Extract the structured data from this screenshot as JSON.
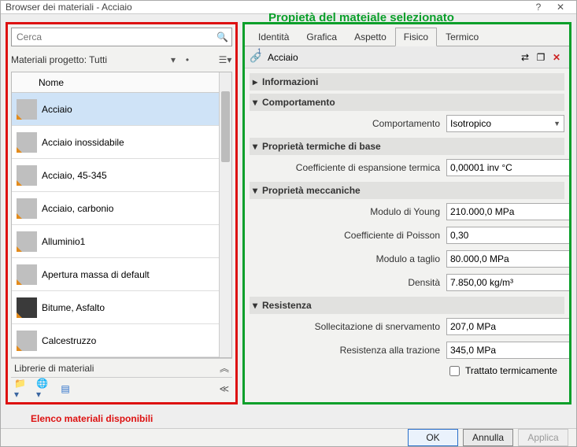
{
  "window": {
    "title": "Browser dei materiali - Acciaio"
  },
  "annotations": {
    "top_green": "Propietà del mateiale selezionato",
    "bottom_red": "Elenco materiali disponibili"
  },
  "search": {
    "placeholder": "Cerca"
  },
  "filter": {
    "label": "Materiali progetto: Tutti"
  },
  "list": {
    "column_header": "Nome",
    "items": [
      {
        "name": "Acciaio",
        "selected": true,
        "dark": false
      },
      {
        "name": "Acciaio inossidabile",
        "selected": false,
        "dark": false
      },
      {
        "name": "Acciaio, 45-345",
        "selected": false,
        "dark": false
      },
      {
        "name": "Acciaio, carbonio",
        "selected": false,
        "dark": false
      },
      {
        "name": "Alluminio1",
        "selected": false,
        "dark": false
      },
      {
        "name": "Apertura massa di default",
        "selected": false,
        "dark": false
      },
      {
        "name": "Bitume, Asfalto",
        "selected": false,
        "dark": true
      },
      {
        "name": "Calcestruzzo",
        "selected": false,
        "dark": false
      }
    ]
  },
  "libraries_header": "Librerie di materiali",
  "tabs": {
    "items": [
      "Identità",
      "Grafica",
      "Aspetto",
      "Fisico",
      "Termico"
    ],
    "active_index": 3
  },
  "material_header": {
    "index": "1",
    "name": "Acciaio"
  },
  "groups": {
    "informazioni": {
      "title": "Informazioni",
      "expanded": false
    },
    "comportamento": {
      "title": "Comportamento",
      "expanded": true,
      "field_label": "Comportamento",
      "field_value": "Isotropico"
    },
    "termiche": {
      "title": "Proprietà termiche di base",
      "expanded": true,
      "coeff_label": "Coefficiente di espansione termica",
      "coeff_value": "0,00001 inv °C"
    },
    "meccaniche": {
      "title": "Proprietà meccaniche",
      "expanded": true,
      "young_label": "Modulo di Young",
      "young_value": "210.000,0 MPa",
      "poisson_label": "Coefficiente di Poisson",
      "poisson_value": "0,30",
      "taglio_label": "Modulo a taglio",
      "taglio_value": "80.000,0 MPa",
      "dens_label": "Densità",
      "dens_value": "7.850,00 kg/m³"
    },
    "resistenza": {
      "title": "Resistenza",
      "expanded": true,
      "snerv_label": "Sollecitazione di snervamento",
      "snerv_value": "207,0 MPa",
      "traz_label": "Resistenza alla trazione",
      "traz_value": "345,0 MPa",
      "heat_label": "Trattato termicamente"
    }
  },
  "buttons": {
    "ok": "OK",
    "cancel": "Annulla",
    "apply": "Applica"
  }
}
